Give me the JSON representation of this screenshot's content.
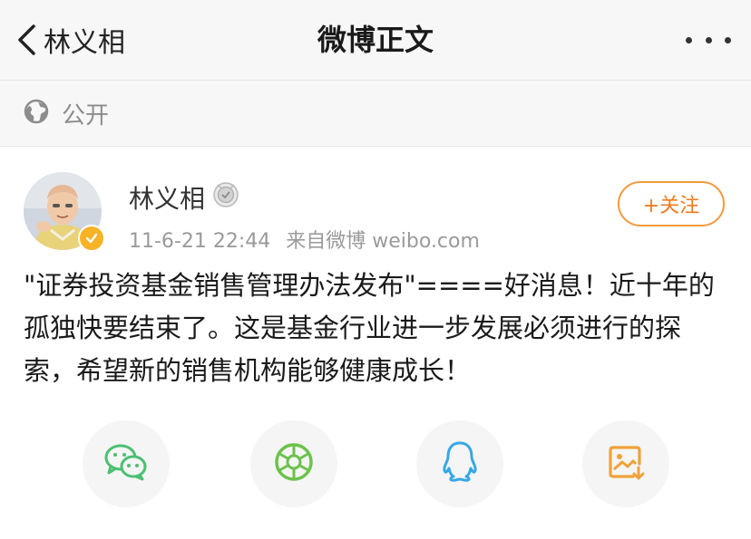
{
  "nav": {
    "back_label": "林义相",
    "title": "微博正文"
  },
  "visibility": {
    "label": "公开"
  },
  "post": {
    "author": "林义相",
    "time": "11-6-21 22:44",
    "source": "来自微博 weibo.com",
    "follow_label": "+关注",
    "text": "\"证券投资基金销售管理办法发布\"====好消息！近十年的孤独快要结束了。这是基金行业进一步发展必须进行的探索，希望新的销售机构能够健康成长！"
  },
  "share": [
    {
      "name": "wechat-icon",
      "color": "#4cbf73"
    },
    {
      "name": "moments-icon",
      "color": "#6cc24a"
    },
    {
      "name": "qq-icon",
      "color": "#35a8e6"
    },
    {
      "name": "save-image-icon",
      "color": "#f0a23a"
    }
  ],
  "colors": {
    "accent": "#f07b1e",
    "verified": "#f6b326",
    "meta_text": "#9a9a9a"
  }
}
